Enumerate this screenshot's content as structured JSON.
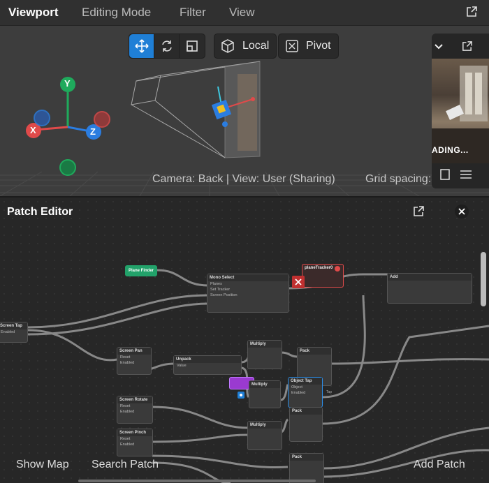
{
  "viewport": {
    "title": "Viewport",
    "menu": [
      "Editing Mode",
      "Filter",
      "View"
    ],
    "toolbar": {
      "local_label": "Local",
      "pivot_label": "Pivot"
    },
    "axes": {
      "x": "X",
      "y": "Y",
      "z": "Z"
    },
    "status": "Camera: Back | View: User (Sharing)",
    "grid": "Grid spacing:",
    "preview": {
      "loading": "ADING..."
    },
    "colors": {
      "accent": "#1f7fd6",
      "x_axis": "#e04a4a",
      "y_axis": "#1faa5c",
      "z_axis": "#2b7de0"
    }
  },
  "patch_editor": {
    "title": "Patch Editor",
    "nodes": {
      "plane_finder": "Plane Finder",
      "mono_select": {
        "title": "Mono Select",
        "rows": [
          "Planes",
          "Set Tracker",
          "Screen Position"
        ]
      },
      "plane_tracker": "planeTracker0",
      "add": "Add",
      "screen_tap": {
        "title": "Screen Tap",
        "rows": [
          "Enabled"
        ]
      },
      "screen_pan": {
        "title": "Screen Pan",
        "rows": [
          "Reset",
          "Enabled"
        ]
      },
      "unpack": {
        "title": "Unpack",
        "rows": [
          "Value"
        ]
      },
      "multiply1": "Multiply",
      "pack1": "Pack",
      "object_tap": {
        "title": "Object Tap",
        "rows": [
          "Object",
          "Enabled"
        ]
      },
      "multiply2": "Multiply",
      "pack2": "Pack",
      "screen_rotate": {
        "title": "Screen Rotate",
        "rows": [
          "Reset",
          "Enabled"
        ]
      },
      "screen_pinch": {
        "title": "Screen Pinch",
        "rows": [
          "Reset",
          "Enabled"
        ]
      },
      "multiply3": "Multiply",
      "pack3": "Pack",
      "tap_label": "Tap"
    },
    "bottom": {
      "show_map": "Show Map",
      "search_patch": "Search Patch",
      "add_patch": "Add Patch"
    }
  }
}
